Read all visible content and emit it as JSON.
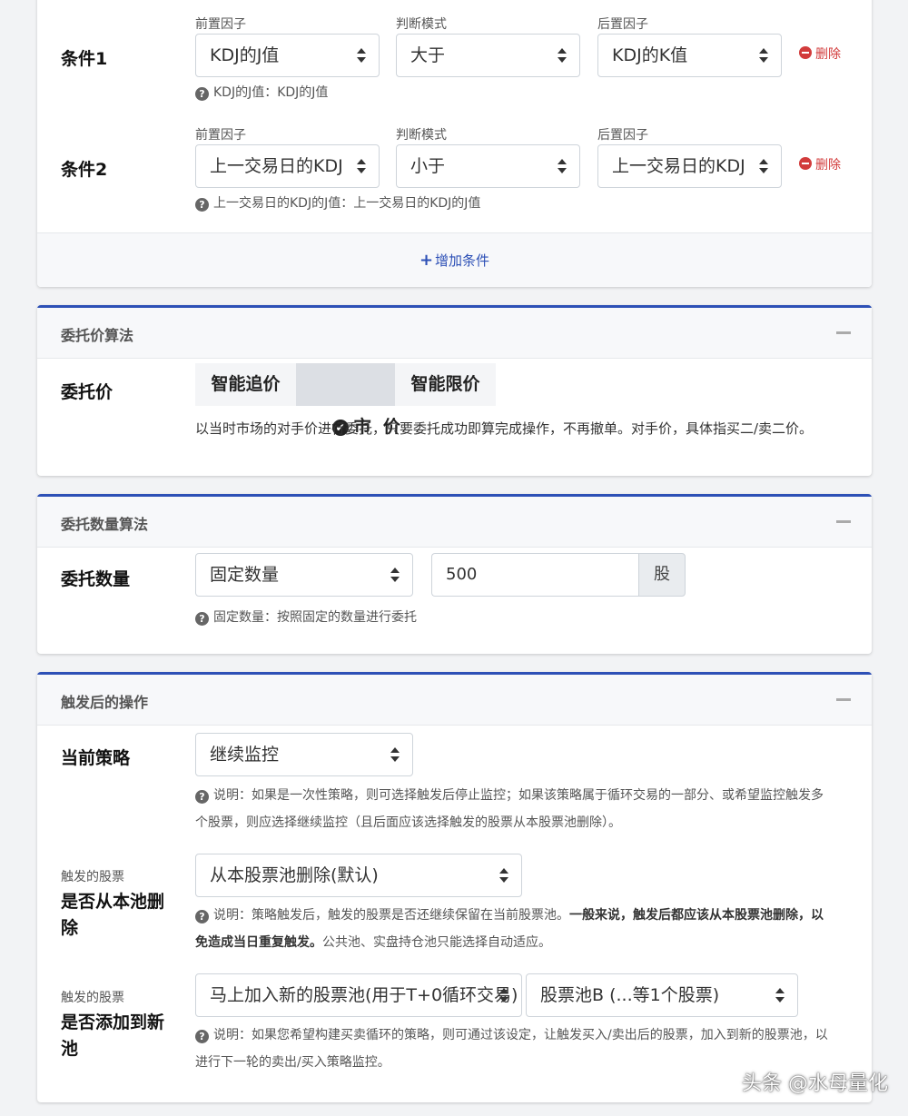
{
  "conditions": {
    "rows": [
      {
        "label": "条件1",
        "pre_caption": "前置因子",
        "pre_value": "KDJ的J值",
        "mode_caption": "判断模式",
        "mode_value": "大于",
        "post_caption": "后置因子",
        "post_value": "KDJ的K值",
        "delete_label": "删除",
        "help": "KDJ的J值：KDJ的J值"
      },
      {
        "label": "条件2",
        "pre_caption": "前置因子",
        "pre_value": "上一交易日的KDJ",
        "mode_caption": "判断模式",
        "mode_value": "小于",
        "post_caption": "后置因子",
        "post_value": "上一交易日的KDJ",
        "delete_label": "删除",
        "help": "上一交易日的KDJ的J值：上一交易日的KDJ的J值"
      }
    ],
    "add_label": "增加条件"
  },
  "price": {
    "title": "委托价算法",
    "label": "委托价",
    "options": [
      "智能追价",
      "市  价",
      "智能限价"
    ],
    "selected": "市  价",
    "description": "以当时市场的对手价进行委托，只要委托成功即算完成操作，不再撤单。对手价，具体指买二/卖二价。"
  },
  "quantity": {
    "title": "委托数量算法",
    "label": "委托数量",
    "mode": "固定数量",
    "amount": "500",
    "unit": "股",
    "help": "固定数量：按照固定的数量进行委托"
  },
  "after": {
    "title": "触发后的操作",
    "strategy_label": "当前策略",
    "strategy_value": "继续监控",
    "strategy_help": "说明：如果是一次性策略，则可选择触发后停止监控；如果该策略属于循环交易的一部分、或希望监控触发多个股票，则应选择继续监控（且后面应该选择触发的股票从本股票池删除）。",
    "remove_small": "触发的股票",
    "remove_label": "是否从本池删除",
    "remove_value": "从本股票池删除(默认)",
    "remove_help_pre": "说明：策略触发后，触发的股票是否还继续保留在当前股票池。",
    "remove_help_bold": "一般来说，触发后都应该从本股票池删除，以免造成当日重复触发。",
    "remove_help_post": "公共池、实盘持仓池只能选择自动适应。",
    "add_small": "触发的股票",
    "add_label": "是否添加到新池",
    "add_value": "马上加入新的股票池(用于T+0循环交易)",
    "pool_value": "股票池B (...等1个股票)",
    "add_help": "说明：如果您希望构建买卖循环的策略，则可通过该设定，让触发买入/卖出后的股票，加入到新的股票池，以进行下一轮的卖出/买入策略监控。"
  },
  "watermark": "头条 @水母量化"
}
